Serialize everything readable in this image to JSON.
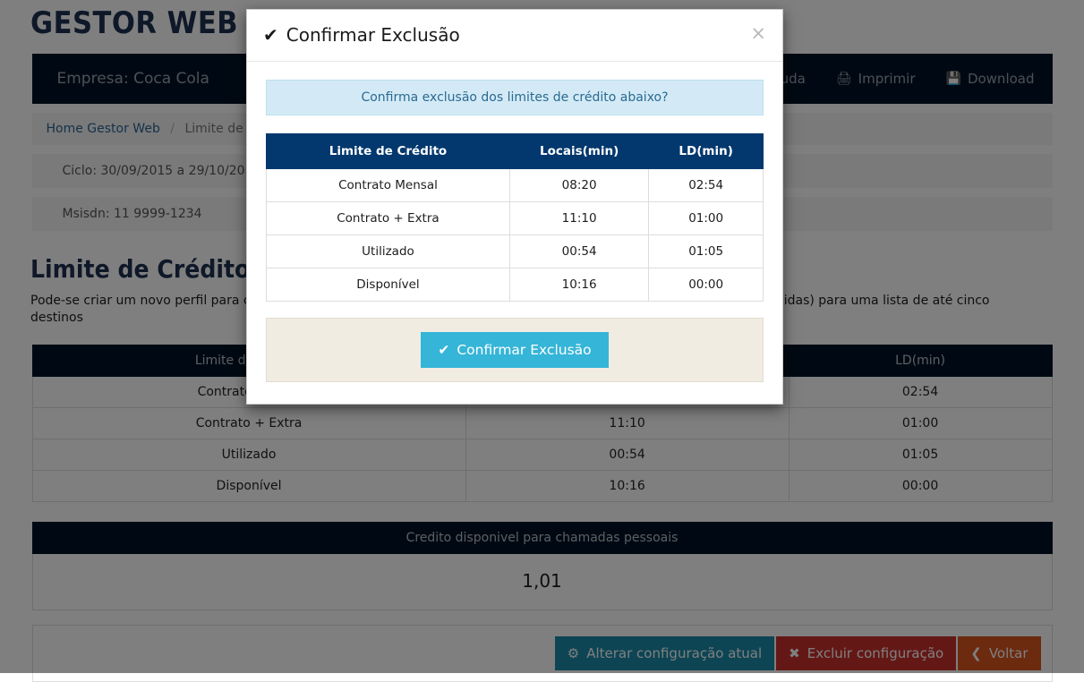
{
  "brand": {
    "title": "GESTOR WEB TIM"
  },
  "navbar": {
    "company": "Empresa: Coca Cola",
    "links": [
      {
        "label": "Ajuda",
        "icon": "help-icon",
        "glyph": "?"
      },
      {
        "label": "Imprimir",
        "icon": "printer-icon",
        "glyph": "⎙"
      },
      {
        "label": "Download",
        "icon": "save-disk-icon",
        "glyph": "ὋE"
      }
    ]
  },
  "breadcrumb": {
    "home": "Home Gestor Web",
    "separator": "/",
    "current": "Limite de Crédito"
  },
  "info": {
    "ciclo": "Ciclo: 30/09/2015 a 29/10/2015",
    "msisdn": "Msisdn: 11 9999-1234"
  },
  "section": {
    "title": "Limite de Crédito",
    "description": "Pode-se criar um novo perfil para cada msisdn, com um limite de crédito para todas as chamadas(ou algumas pré-definidas) para uma lista de até cinco destinos"
  },
  "limits_table": {
    "headers": [
      "Limite de Crédito",
      "Locais(min)",
      "LD(min)"
    ],
    "rows": [
      {
        "label": "Contrato Mensal",
        "locais": "08:20",
        "ld": "02:54"
      },
      {
        "label": "Contrato + Extra",
        "locais": "11:10",
        "ld": "01:00"
      },
      {
        "label": "Utilizado",
        "locais": "00:54",
        "ld": "01:05"
      },
      {
        "label": "Disponível",
        "locais": "10:16",
        "ld": "00:00"
      }
    ]
  },
  "credit_panel": {
    "header": "Credito disponivel para chamadas pessoais",
    "value": "1,01"
  },
  "actions": {
    "alter": {
      "label": "Alterar configuração atual",
      "icon": "gear-icon",
      "glyph": "⚙"
    },
    "delete": {
      "label": "Excluir configuração",
      "icon": "x-mark-icon",
      "glyph": "✖"
    },
    "back": {
      "label": "Voltar",
      "icon": "chevron-left-icon",
      "glyph": "❮"
    }
  },
  "modal": {
    "title": "Confirmar Exclusão",
    "title_icon": "check-mark-icon",
    "title_glyph": "✔",
    "close_glyph": "×",
    "alert": "Confirma exclusão dos limites de crédito abaixo?",
    "table": {
      "headers": [
        "Limite de Crédito",
        "Locais(min)",
        "LD(min)"
      ],
      "rows": [
        {
          "label": "Contrato Mensal",
          "locais": "08:20",
          "ld": "02:54"
        },
        {
          "label": "Contrato + Extra",
          "locais": "11:10",
          "ld": "01:00"
        },
        {
          "label": "Utilizado",
          "locais": "00:54",
          "ld": "01:05"
        },
        {
          "label": "Disponível",
          "locais": "10:16",
          "ld": "00:00"
        }
      ]
    },
    "confirm_button": {
      "label": "Confirmar Exclusão",
      "icon": "check-mark-icon",
      "glyph": "✔"
    }
  },
  "colors": {
    "navy": "#001227",
    "modal_header_navy": "#02386e",
    "brand_text": "#1c3050",
    "alert_info_bg": "#d3eaf6",
    "confirm_button": "#35b5d8",
    "footer_panel": "#f0ece1",
    "teal_button": "#1a8ba8",
    "orange_button": "#d9541f"
  }
}
